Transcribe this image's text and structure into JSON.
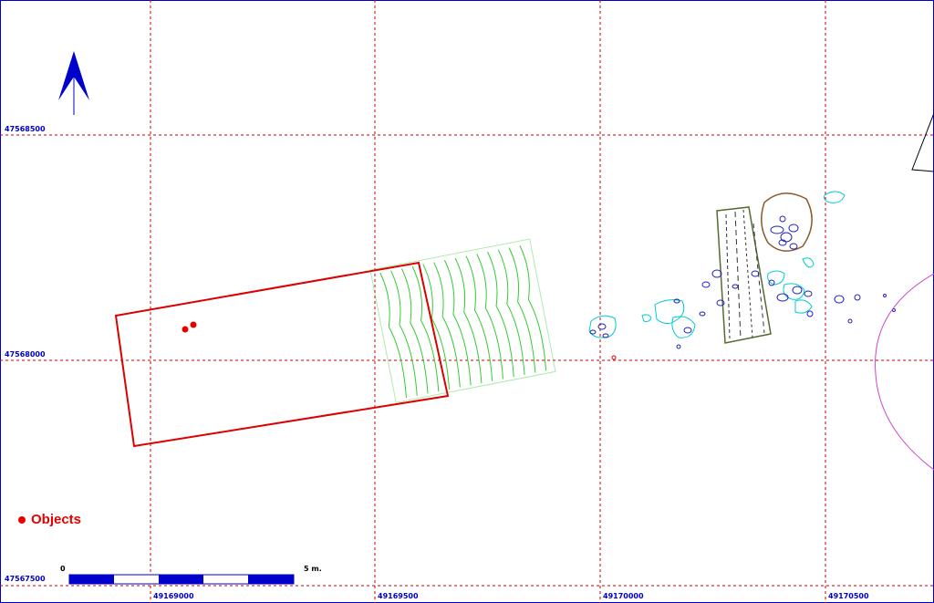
{
  "map": {
    "grid_x_labels": [
      "49169000",
      "49169500",
      "49170000",
      "49170500"
    ],
    "grid_y_labels": [
      "47568500",
      "47568000",
      "47567500"
    ],
    "legend": {
      "label": "Objects",
      "color": "#e60000"
    },
    "scale_bar": {
      "start_label": "0",
      "end_label": "5 m."
    },
    "north_arrow": "north-arrow-icon",
    "colors": {
      "grid": "#cc0000",
      "frame": "#0000cc",
      "excavation_outline": "#dd0000",
      "hatch_area": "#33cc33",
      "trench": "#556b2f",
      "stones_dark": "#2222bb",
      "stones_light": "#00cccc",
      "pit": "#8b5a2b",
      "boundary_arc": "#cc44cc"
    }
  }
}
